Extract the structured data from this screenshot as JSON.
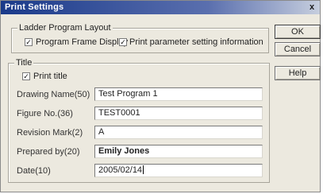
{
  "window": {
    "title": "Print Settings",
    "close_glyph": "x"
  },
  "ladder_group": {
    "legend": "Ladder Program Layout",
    "options": [
      {
        "label": "Program Frame Display",
        "checked": true
      },
      {
        "label": "Print parameter setting information",
        "checked": true
      }
    ]
  },
  "title_group": {
    "legend": "Title",
    "print_title": {
      "label": "Print title",
      "checked": true
    },
    "fields": [
      {
        "label": "Drawing Name(50)",
        "value": "Test Program 1"
      },
      {
        "label": "Figure No.(36)",
        "value": "TEST0001"
      },
      {
        "label": "Revision Mark(2)",
        "value": "A"
      },
      {
        "label": "Prepared by(20)",
        "value": "Emily Jones"
      },
      {
        "label": "Date(10)",
        "value": "2005/02/14"
      }
    ]
  },
  "buttons": {
    "ok": "OK",
    "cancel": "Cancel",
    "help": "Help"
  },
  "check_glyph": "✓"
}
